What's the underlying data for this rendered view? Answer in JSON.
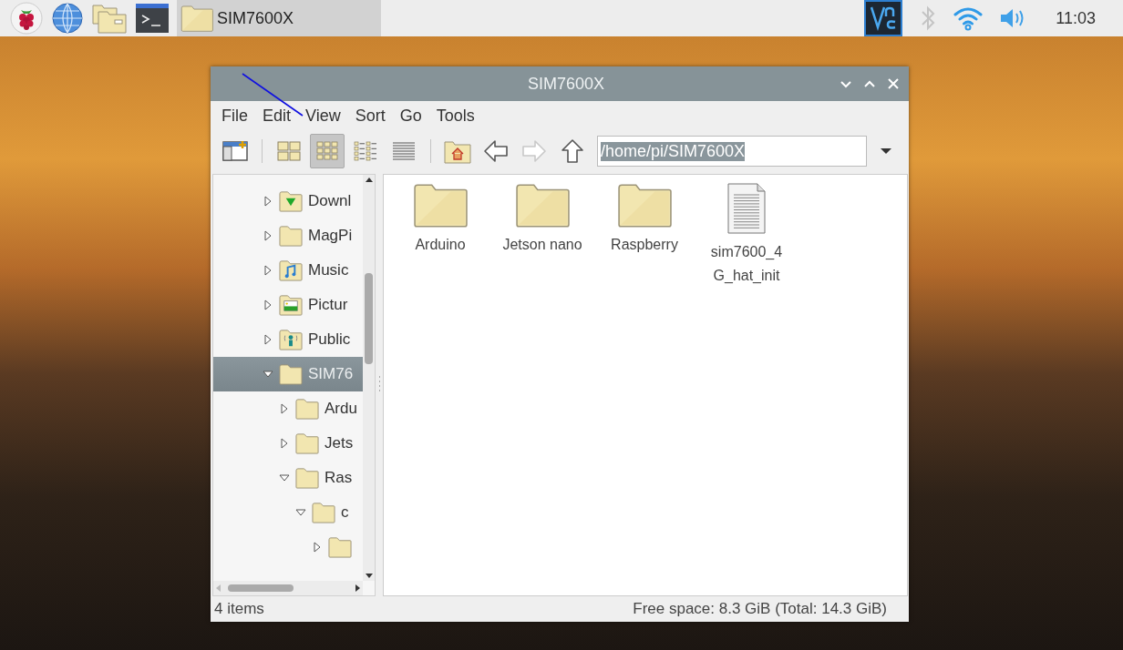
{
  "taskbar": {
    "launchers": [
      {
        "kind": "raspberry"
      },
      {
        "kind": "globe"
      },
      {
        "kind": "files"
      },
      {
        "kind": "terminal"
      }
    ],
    "tasks": [
      {
        "label": "SIM7600X",
        "active": true
      }
    ],
    "tray": [
      {
        "kind": "vnc"
      },
      {
        "kind": "bluetooth"
      },
      {
        "kind": "wifi"
      },
      {
        "kind": "volume"
      }
    ],
    "clock": "11:03"
  },
  "window": {
    "title": "SIM7600X",
    "menu": [
      "File",
      "Edit",
      "View",
      "Sort",
      "Go",
      "Tools"
    ],
    "toolbar": {
      "view_modes": [
        {
          "kind": "thumbnail",
          "selected": false
        },
        {
          "kind": "icon",
          "selected": true
        },
        {
          "kind": "compact",
          "selected": false
        },
        {
          "kind": "list",
          "selected": false
        }
      ],
      "nav": [
        {
          "kind": "home",
          "disabled": false
        },
        {
          "kind": "back",
          "disabled": false
        },
        {
          "kind": "forward",
          "disabled": true
        },
        {
          "kind": "up",
          "disabled": false
        }
      ],
      "path": {
        "value": "/home/pi/SIM7600X",
        "selected": true
      }
    },
    "sidebar": {
      "tree": [
        {
          "label": "Downl",
          "kind": "downloads",
          "expanded": false,
          "selected": false
        },
        {
          "label": "MagPi",
          "kind": "folder",
          "expanded": false,
          "selected": false
        },
        {
          "label": "Music",
          "kind": "music",
          "expanded": false,
          "selected": false
        },
        {
          "label": "Pictur",
          "kind": "pictures",
          "expanded": false,
          "selected": false
        },
        {
          "label": "Public",
          "kind": "public",
          "expanded": false,
          "selected": false
        },
        {
          "label": "SIM76",
          "kind": "folder",
          "expanded": true,
          "selected": true,
          "children": [
            {
              "label": "Ardu",
              "kind": "folder",
              "expanded": false,
              "selected": false
            },
            {
              "label": "Jets",
              "kind": "folder",
              "expanded": false,
              "selected": false
            },
            {
              "label": "Ras",
              "kind": "folder",
              "expanded": true,
              "selected": false,
              "children": [
                {
                  "label": "c",
                  "kind": "folder",
                  "expanded": true,
                  "selected": false,
                  "children": [
                    {
                      "kind": "folder",
                      "expanded": false,
                      "selected": false
                    }
                  ]
                }
              ]
            }
          ]
        }
      ]
    },
    "files": [
      {
        "name": "Arduino",
        "kind": "folder"
      },
      {
        "name": "Jetson nano",
        "kind": "folder"
      },
      {
        "name": "Raspberry",
        "kind": "folder"
      },
      {
        "name": "sim7600_4G_hat_init",
        "kind": "document"
      }
    ],
    "status_bar": {
      "count": "4 items",
      "free_space": "Free space: 8.3 GiB (Total: 14.3 GiB)"
    }
  }
}
